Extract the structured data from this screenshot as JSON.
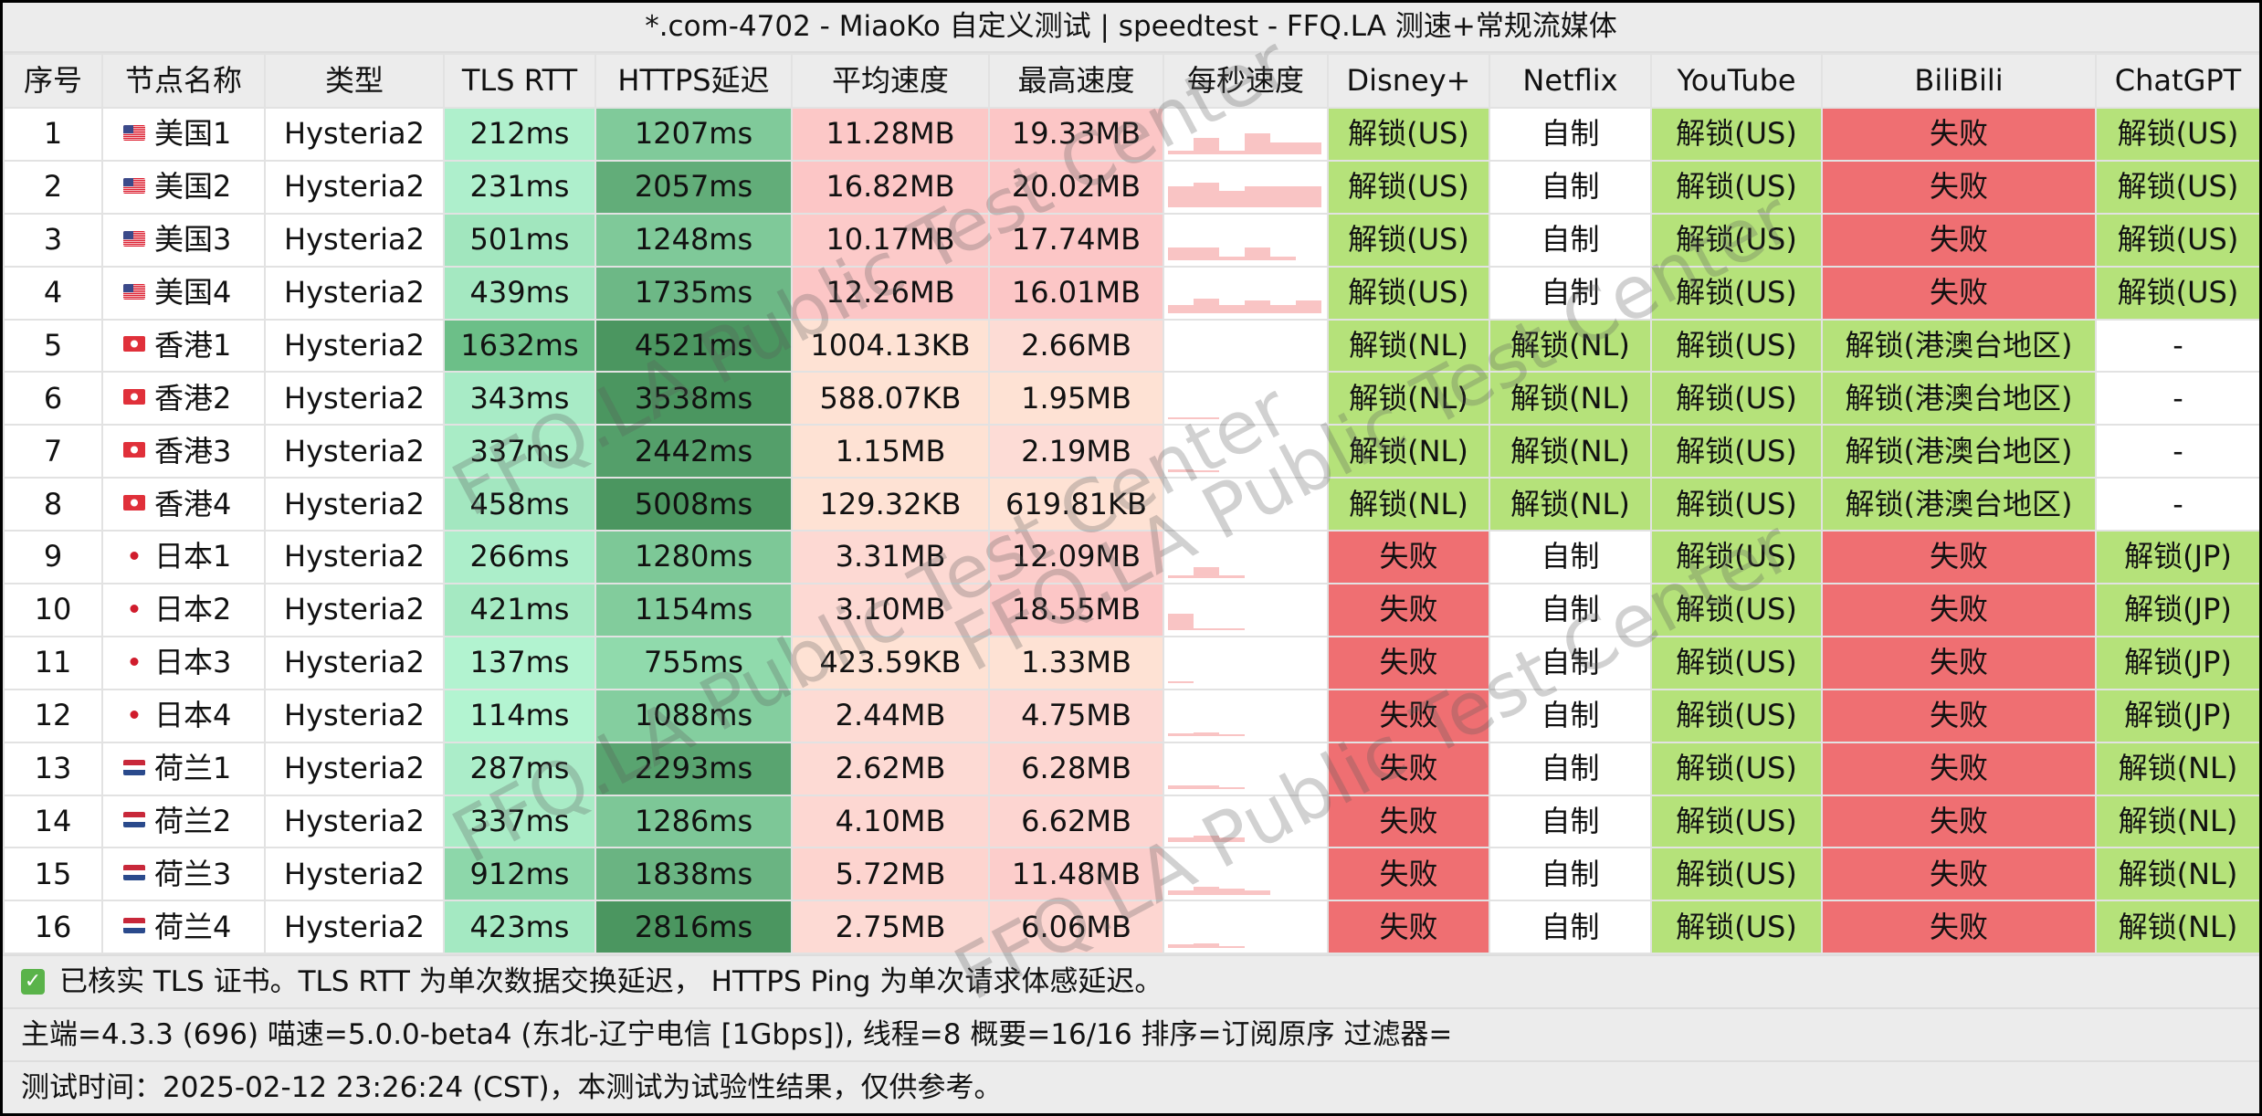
{
  "title": "*.com-4702 - MiaoKo 自定义测试 | speedtest - FFQ.LA 测速+常规流媒体",
  "columns": [
    "序号",
    "节点名称",
    "类型",
    "TLS RTT",
    "HTTPS延迟",
    "平均速度",
    "最高速度",
    "每秒速度",
    "Disney+",
    "Netflix",
    "YouTube",
    "BiliBili",
    "ChatGPT"
  ],
  "colors": {
    "unlock": "#b5e27a",
    "fail": "#ef6f72",
    "self": "#ffffff"
  },
  "rows": [
    {
      "id": "1",
      "flag": "us",
      "name": "美国1",
      "type": "Hysteria2",
      "tls": "212ms",
      "https": "1207ms",
      "avg": "11.28MB",
      "max": "19.33MB",
      "spark": [
        0.1,
        0.4,
        0.1,
        0.5,
        0.3,
        0.3
      ],
      "disney": "解锁(US)",
      "netflix": "自制",
      "youtube": "解锁(US)",
      "bili": "失败",
      "gpt": "解锁(US)"
    },
    {
      "id": "2",
      "flag": "us",
      "name": "美国2",
      "type": "Hysteria2",
      "tls": "231ms",
      "https": "2057ms",
      "avg": "16.82MB",
      "max": "20.02MB",
      "spark": [
        0.5,
        0.6,
        0.4,
        0.5,
        0.5,
        0.5
      ],
      "disney": "解锁(US)",
      "netflix": "自制",
      "youtube": "解锁(US)",
      "bili": "失败",
      "gpt": "解锁(US)"
    },
    {
      "id": "3",
      "flag": "us",
      "name": "美国3",
      "type": "Hysteria2",
      "tls": "501ms",
      "https": "1248ms",
      "avg": "10.17MB",
      "max": "17.74MB",
      "spark": [
        0.3,
        0.3,
        0.1,
        0.3,
        0.1,
        0
      ],
      "disney": "解锁(US)",
      "netflix": "自制",
      "youtube": "解锁(US)",
      "bili": "失败",
      "gpt": "解锁(US)"
    },
    {
      "id": "4",
      "flag": "us",
      "name": "美国4",
      "type": "Hysteria2",
      "tls": "439ms",
      "https": "1735ms",
      "avg": "12.26MB",
      "max": "16.01MB",
      "spark": [
        0.2,
        0.35,
        0.2,
        0.3,
        0.2,
        0.3
      ],
      "disney": "解锁(US)",
      "netflix": "自制",
      "youtube": "解锁(US)",
      "bili": "失败",
      "gpt": "解锁(US)"
    },
    {
      "id": "5",
      "flag": "hk",
      "name": "香港1",
      "type": "Hysteria2",
      "tls": "1632ms",
      "https": "4521ms",
      "avg": "1004.13KB",
      "max": "2.66MB",
      "spark": [
        0,
        0,
        0,
        0,
        0,
        0
      ],
      "disney": "解锁(NL)",
      "netflix": "解锁(NL)",
      "youtube": "解锁(US)",
      "bili": "解锁(港澳台地区)",
      "gpt": "-"
    },
    {
      "id": "6",
      "flag": "hk",
      "name": "香港2",
      "type": "Hysteria2",
      "tls": "343ms",
      "https": "3538ms",
      "avg": "588.07KB",
      "max": "1.95MB",
      "spark": [
        0.03,
        0.03,
        0,
        0,
        0,
        0
      ],
      "disney": "解锁(NL)",
      "netflix": "解锁(NL)",
      "youtube": "解锁(US)",
      "bili": "解锁(港澳台地区)",
      "gpt": "-"
    },
    {
      "id": "7",
      "flag": "hk",
      "name": "香港3",
      "type": "Hysteria2",
      "tls": "337ms",
      "https": "2442ms",
      "avg": "1.15MB",
      "max": "2.19MB",
      "spark": [
        0.05,
        0.03,
        0,
        0,
        0,
        0
      ],
      "disney": "解锁(NL)",
      "netflix": "解锁(NL)",
      "youtube": "解锁(US)",
      "bili": "解锁(港澳台地区)",
      "gpt": "-"
    },
    {
      "id": "8",
      "flag": "hk",
      "name": "香港4",
      "type": "Hysteria2",
      "tls": "458ms",
      "https": "5008ms",
      "avg": "129.32KB",
      "max": "619.81KB",
      "spark": [
        0,
        0,
        0,
        0,
        0,
        0
      ],
      "disney": "解锁(NL)",
      "netflix": "解锁(NL)",
      "youtube": "解锁(US)",
      "bili": "解锁(港澳台地区)",
      "gpt": "-"
    },
    {
      "id": "9",
      "flag": "jp",
      "name": "日本1",
      "type": "Hysteria2",
      "tls": "266ms",
      "https": "1280ms",
      "avg": "3.31MB",
      "max": "12.09MB",
      "spark": [
        0.05,
        0.25,
        0.05,
        0,
        0,
        0
      ],
      "disney": "失败",
      "netflix": "自制",
      "youtube": "解锁(US)",
      "bili": "失败",
      "gpt": "解锁(JP)"
    },
    {
      "id": "10",
      "flag": "jp",
      "name": "日本2",
      "type": "Hysteria2",
      "tls": "421ms",
      "https": "1154ms",
      "avg": "3.10MB",
      "max": "18.55MB",
      "spark": [
        0.4,
        0.05,
        0.05,
        0,
        0,
        0
      ],
      "disney": "失败",
      "netflix": "自制",
      "youtube": "解锁(US)",
      "bili": "失败",
      "gpt": "解锁(JP)"
    },
    {
      "id": "11",
      "flag": "jp",
      "name": "日本3",
      "type": "Hysteria2",
      "tls": "137ms",
      "https": "755ms",
      "avg": "423.59KB",
      "max": "1.33MB",
      "spark": [
        0.03,
        0,
        0,
        0,
        0,
        0
      ],
      "disney": "失败",
      "netflix": "自制",
      "youtube": "解锁(US)",
      "bili": "失败",
      "gpt": "解锁(JP)"
    },
    {
      "id": "12",
      "flag": "jp",
      "name": "日本4",
      "type": "Hysteria2",
      "tls": "114ms",
      "https": "1088ms",
      "avg": "2.44MB",
      "max": "4.75MB",
      "spark": [
        0.08,
        0.1,
        0.05,
        0,
        0,
        0
      ],
      "disney": "失败",
      "netflix": "自制",
      "youtube": "解锁(US)",
      "bili": "失败",
      "gpt": "解锁(JP)"
    },
    {
      "id": "13",
      "flag": "nl",
      "name": "荷兰1",
      "type": "Hysteria2",
      "tls": "287ms",
      "https": "2293ms",
      "avg": "2.62MB",
      "max": "6.28MB",
      "spark": [
        0.1,
        0.1,
        0.05,
        0,
        0,
        0
      ],
      "disney": "失败",
      "netflix": "自制",
      "youtube": "解锁(US)",
      "bili": "失败",
      "gpt": "解锁(NL)"
    },
    {
      "id": "14",
      "flag": "nl",
      "name": "荷兰2",
      "type": "Hysteria2",
      "tls": "337ms",
      "https": "1286ms",
      "avg": "4.10MB",
      "max": "6.62MB",
      "spark": [
        0.1,
        0.15,
        0.1,
        0,
        0,
        0
      ],
      "disney": "失败",
      "netflix": "自制",
      "youtube": "解锁(US)",
      "bili": "失败",
      "gpt": "解锁(NL)"
    },
    {
      "id": "15",
      "flag": "nl",
      "name": "荷兰3",
      "type": "Hysteria2",
      "tls": "912ms",
      "https": "1838ms",
      "avg": "5.72MB",
      "max": "11.48MB",
      "spark": [
        0.1,
        0.2,
        0.15,
        0.1,
        0,
        0
      ],
      "disney": "失败",
      "netflix": "自制",
      "youtube": "解锁(US)",
      "bili": "失败",
      "gpt": "解锁(NL)"
    },
    {
      "id": "16",
      "flag": "nl",
      "name": "荷兰4",
      "type": "Hysteria2",
      "tls": "423ms",
      "https": "2816ms",
      "avg": "2.75MB",
      "max": "6.06MB",
      "spark": [
        0.08,
        0.1,
        0.05,
        0,
        0,
        0
      ],
      "disney": "失败",
      "netflix": "自制",
      "youtube": "解锁(US)",
      "bili": "失败",
      "gpt": "解锁(NL)"
    }
  ],
  "footer": {
    "note": "已核实 TLS 证书。TLS RTT 为单次数据交换延迟， HTTPS Ping 为单次请求体感延迟。",
    "info": "主端=4.3.3 (696) 喵速=5.0.0-beta4 (东北-辽宁电信 [1Gbps]), 线程=8 概要=16/16 排序=订阅原序 过滤器=",
    "time": "测试时间：2025-02-12 23:26:24 (CST)，本测试为试验性结果，仅供参考。"
  },
  "watermark": "FFQ.LA Public Test Center"
}
